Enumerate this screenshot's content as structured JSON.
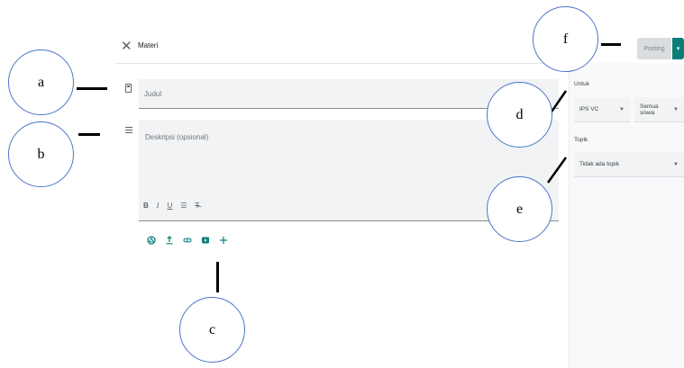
{
  "header": {
    "close_icon": "close-icon",
    "title": "Materi",
    "post_button": "Posting",
    "post_dropdown_icon": "caret-down-icon"
  },
  "form": {
    "title_placeholder": "Judul",
    "description_placeholder": "Deskripsi (opsional)",
    "format_bar": [
      "B",
      "I",
      "U",
      "☰",
      "T̶"
    ],
    "attachment_icons": [
      "drive-icon",
      "upload-icon",
      "link-icon",
      "youtube-icon",
      "add-icon"
    ]
  },
  "side": {
    "for_label": "Untuk",
    "class_select": "IPS VC",
    "students_select": "Semua siswa",
    "topic_label": "Topik",
    "topic_select": "Tidak ada topik"
  },
  "annotations": [
    "a",
    "b",
    "c",
    "d",
    "e",
    "f"
  ],
  "colors": {
    "accent": "#0b7f77",
    "annotation_circle": "#4a74c9"
  }
}
